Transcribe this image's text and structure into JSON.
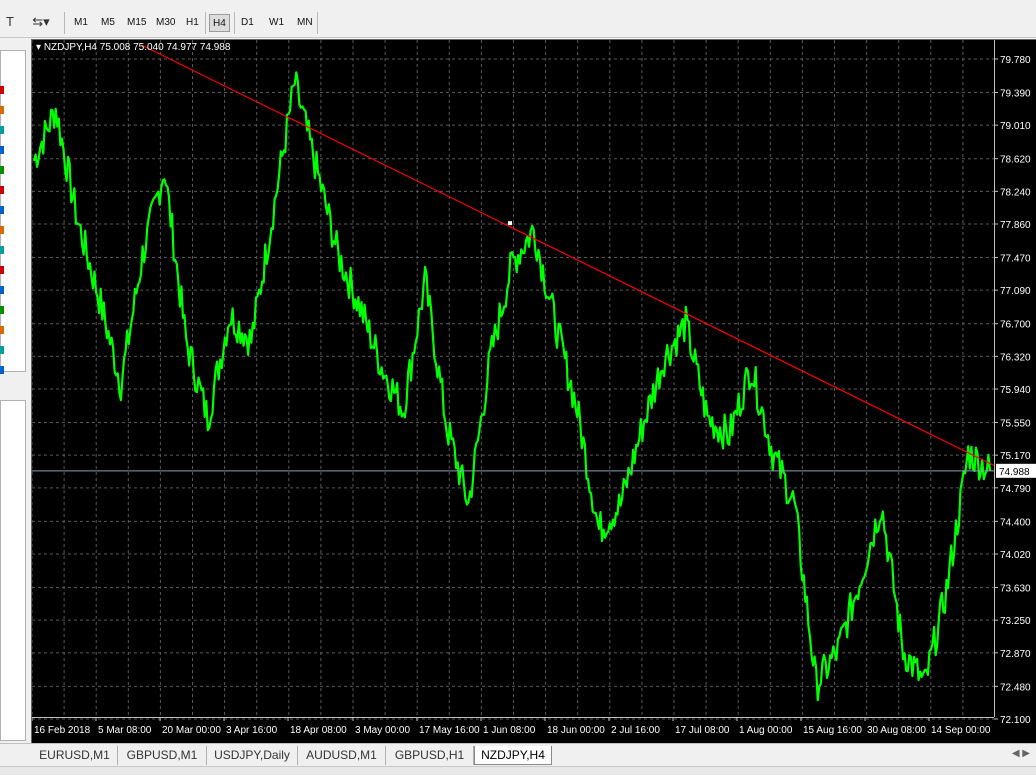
{
  "toolbar": {
    "timeframes": [
      {
        "label": "M1",
        "active": false
      },
      {
        "label": "M5",
        "active": false
      },
      {
        "label": "M15",
        "active": false
      },
      {
        "label": "M30",
        "active": false
      },
      {
        "label": "H1",
        "active": false
      },
      {
        "label": "H4",
        "active": true
      },
      {
        "label": "D1",
        "active": false
      },
      {
        "label": "W1",
        "active": false
      },
      {
        "label": "MN",
        "active": false
      }
    ]
  },
  "chart": {
    "header": "NZDJPY,H4  75.008 75.040 74.977 74.988",
    "current_price": "74.988",
    "colors": {
      "background": "#000000",
      "grid": "#5a5a5a",
      "candles": "#00ff00",
      "trendline": "#ff0000",
      "price_line": "#8aa0b4",
      "axis_text": "#ffffff"
    }
  },
  "chart_data": {
    "type": "line",
    "title": "NZDJPY,H4",
    "x_tick_labels": [
      "16 Feb 2018",
      "5 Mar 08:00",
      "20 Mar 00:00",
      "3 Apr 16:00",
      "18 Apr 08:00",
      "3 May 00:00",
      "17 May 16:00",
      "1 Jun 08:00",
      "18 Jun 00:00",
      "2 Jul 16:00",
      "17 Jul 08:00",
      "1 Aug 00:00",
      "15 Aug 16:00",
      "30 Aug 08:00",
      "14 Sep 00:00"
    ],
    "y_tick_labels": [
      "79.780",
      "79.390",
      "79.010",
      "78.620",
      "78.240",
      "77.860",
      "77.470",
      "77.090",
      "76.700",
      "76.320",
      "75.940",
      "75.550",
      "75.170",
      "74.790",
      "74.400",
      "74.020",
      "73.630",
      "73.250",
      "72.870",
      "72.480",
      "72.100"
    ],
    "ylim": [
      72.1,
      79.78
    ],
    "grid": true,
    "series": [
      {
        "values": [
          {
            "x": "16 Feb 2018",
            "y": 78.6
          },
          {
            "x": "22 Feb",
            "y": 79.2
          },
          {
            "x": "28 Feb",
            "y": 77.9
          },
          {
            "x": "5 Mar 08:00",
            "y": 77.0
          },
          {
            "x": "8 Mar",
            "y": 76.0
          },
          {
            "x": "12 Mar",
            "y": 77.5
          },
          {
            "x": "15 Mar",
            "y": 78.5
          },
          {
            "x": "20 Mar 00:00",
            "y": 76.5
          },
          {
            "x": "24 Mar",
            "y": 75.6
          },
          {
            "x": "28 Mar",
            "y": 76.8
          },
          {
            "x": "3 Apr 16:00",
            "y": 76.5
          },
          {
            "x": "7 Apr",
            "y": 78.0
          },
          {
            "x": "12 Apr",
            "y": 79.5
          },
          {
            "x": "18 Apr 08:00",
            "y": 78.5
          },
          {
            "x": "22 Apr",
            "y": 77.5
          },
          {
            "x": "28 Apr",
            "y": 76.9
          },
          {
            "x": "3 May 00:00",
            "y": 76.2
          },
          {
            "x": "9 May",
            "y": 75.7
          },
          {
            "x": "13 May",
            "y": 77.2
          },
          {
            "x": "17 May 16:00",
            "y": 75.5
          },
          {
            "x": "22 May",
            "y": 74.6
          },
          {
            "x": "27 May",
            "y": 76.3
          },
          {
            "x": "1 Jun 08:00",
            "y": 77.4
          },
          {
            "x": "6 Jun",
            "y": 77.8
          },
          {
            "x": "12 Jun",
            "y": 76.7
          },
          {
            "x": "18 Jun 00:00",
            "y": 75.7
          },
          {
            "x": "24 Jun",
            "y": 74.3
          },
          {
            "x": "28 Jun",
            "y": 74.6
          },
          {
            "x": "2 Jul 16:00",
            "y": 75.5
          },
          {
            "x": "8 Jul",
            "y": 76.3
          },
          {
            "x": "12 Jul",
            "y": 76.7
          },
          {
            "x": "17 Jul 08:00",
            "y": 75.6
          },
          {
            "x": "22 Jul",
            "y": 75.4
          },
          {
            "x": "27 Jul",
            "y": 76.2
          },
          {
            "x": "1 Aug 00:00",
            "y": 75.2
          },
          {
            "x": "6 Aug",
            "y": 74.6
          },
          {
            "x": "9 Aug",
            "y": 72.5
          },
          {
            "x": "15 Aug 16:00",
            "y": 72.9
          },
          {
            "x": "20 Aug",
            "y": 73.7
          },
          {
            "x": "25 Aug",
            "y": 74.6
          },
          {
            "x": "30 Aug 08:00",
            "y": 72.9
          },
          {
            "x": "4 Sep",
            "y": 72.5
          },
          {
            "x": "9 Sep",
            "y": 73.6
          },
          {
            "x": "14 Sep 00:00",
            "y": 75.2
          },
          {
            "x": "19 Sep",
            "y": 74.99
          }
        ]
      }
    ],
    "trendline": {
      "from": {
        "x": "16 Feb 2018",
        "y": 79.94
      },
      "to": {
        "x": "20 Sep",
        "y": 75.05
      }
    },
    "current_price_line": 74.988
  },
  "leftpanel": {
    "colors": [
      "#d00000",
      "#d86a00",
      "#00a0a0",
      "#0060d0",
      "#009000",
      "#d00000",
      "#0060d0",
      "#d86a00",
      "#00a0a0",
      "#d00000",
      "#0060d0",
      "#009000",
      "#d86a00",
      "#00a0a0",
      "#0060d0"
    ]
  },
  "tabs": [
    {
      "label": "EURUSD,M1",
      "active": false
    },
    {
      "label": "GBPUSD,M1",
      "active": false
    },
    {
      "label": "USDJPY,Daily",
      "active": false
    },
    {
      "label": "AUDUSD,M1",
      "active": false
    },
    {
      "label": "GBPUSD,H1",
      "active": false
    },
    {
      "label": "NZDJPY,H4",
      "active": true
    }
  ]
}
